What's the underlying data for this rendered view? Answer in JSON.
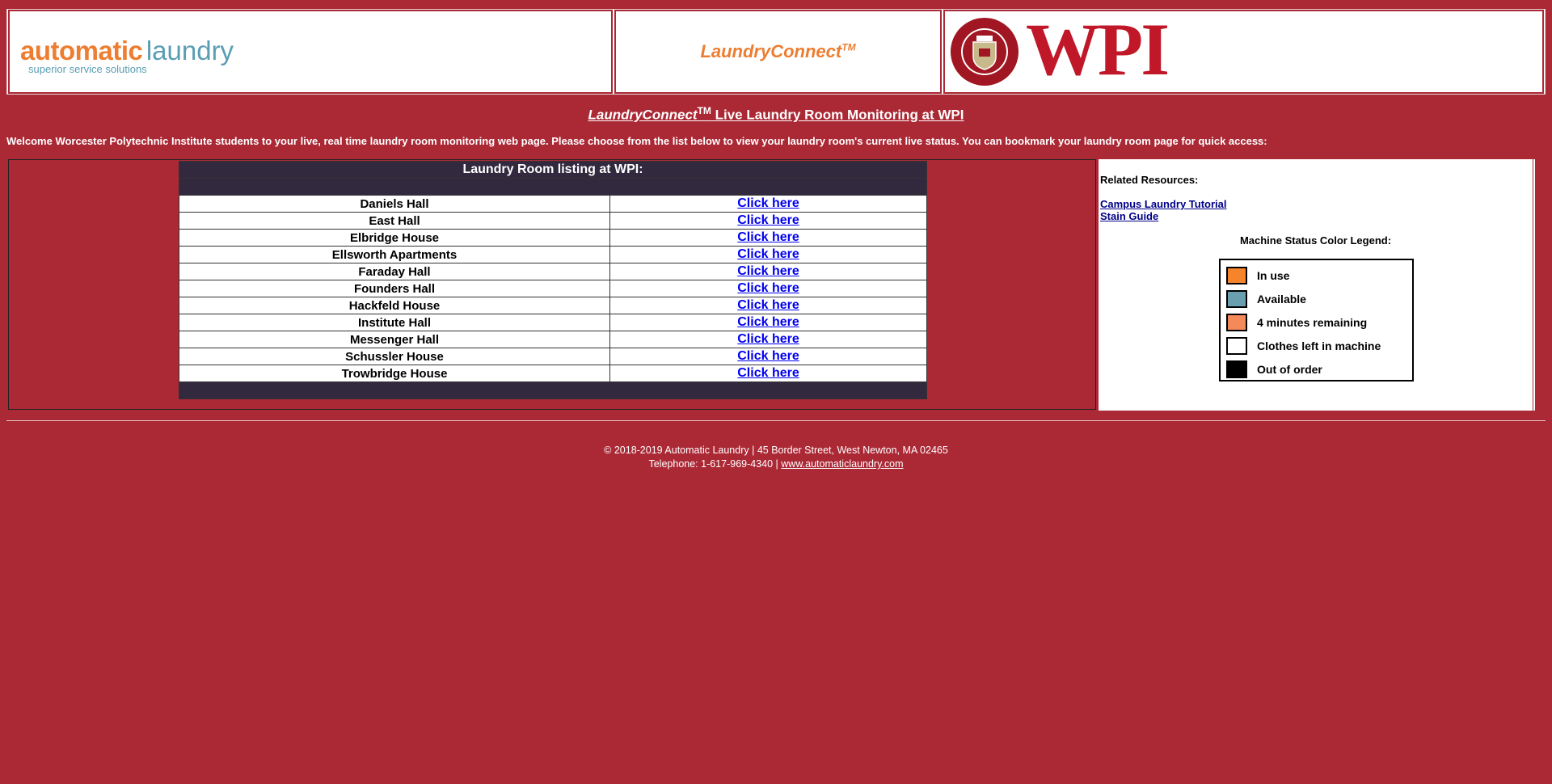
{
  "header": {
    "logo_auto": "automatic",
    "logo_laundry": "laundry",
    "logo_tagline": "superior service solutions",
    "brand": "LaundryConnect",
    "brand_tm": "TM",
    "wpi_logo": "WPI",
    "wpi_seal_text": "WORCESTER POLYTECHNIC INSTITUTE 1865"
  },
  "title": {
    "brand": "LaundryConnect",
    "tm": "TM",
    "rest": " Live Laundry Room Monitoring at WPI"
  },
  "welcome_text": "Welcome Worcester Polytechnic Institute students to your live, real time laundry room monitoring web page. Please choose from the list below to view your laundry room's current live status. You can bookmark your laundry room page for quick access:",
  "room_listing": {
    "header": "Laundry Room listing at WPI:",
    "rooms": [
      {
        "name": "Daniels Hall",
        "link": "Click here"
      },
      {
        "name": "East Hall",
        "link": "Click here"
      },
      {
        "name": "Elbridge House",
        "link": "Click here"
      },
      {
        "name": "Ellsworth Apartments",
        "link": "Click here"
      },
      {
        "name": "Faraday Hall",
        "link": "Click here"
      },
      {
        "name": "Founders Hall",
        "link": "Click here"
      },
      {
        "name": "Hackfeld House",
        "link": "Click here"
      },
      {
        "name": "Institute Hall",
        "link": "Click here"
      },
      {
        "name": "Messenger Hall",
        "link": "Click here"
      },
      {
        "name": "Schussler House",
        "link": "Click here"
      },
      {
        "name": "Trowbridge House",
        "link": "Click here"
      }
    ]
  },
  "resources": {
    "heading": "Related Resources:",
    "links": [
      "Campus Laundry Tutorial",
      "Stain Guide"
    ]
  },
  "legend": {
    "title": "Machine Status Color Legend:",
    "items": [
      {
        "label": "In use",
        "color": "#f5842a"
      },
      {
        "label": "Available",
        "color": "#6a9fb0"
      },
      {
        "label": "4 minutes remaining",
        "color": "#f4895a"
      },
      {
        "label": "Clothes left in machine",
        "color": "#ffffff"
      },
      {
        "label": "Out of order",
        "color": "#000000"
      }
    ]
  },
  "footer": {
    "line1": "© 2018-2019 Automatic Laundry  |  45 Border Street, West Newton, MA 02465",
    "line2_prefix": "Telephone: 1-617-969-4340  |  ",
    "website": "www.automaticlaundry.com"
  },
  "colors": {
    "page_bg": "#ab2835",
    "table_header_bg": "#32293f",
    "wpi_red": "#c01829",
    "brand_orange": "#ed7d31",
    "brand_blue": "#5a9db3"
  }
}
